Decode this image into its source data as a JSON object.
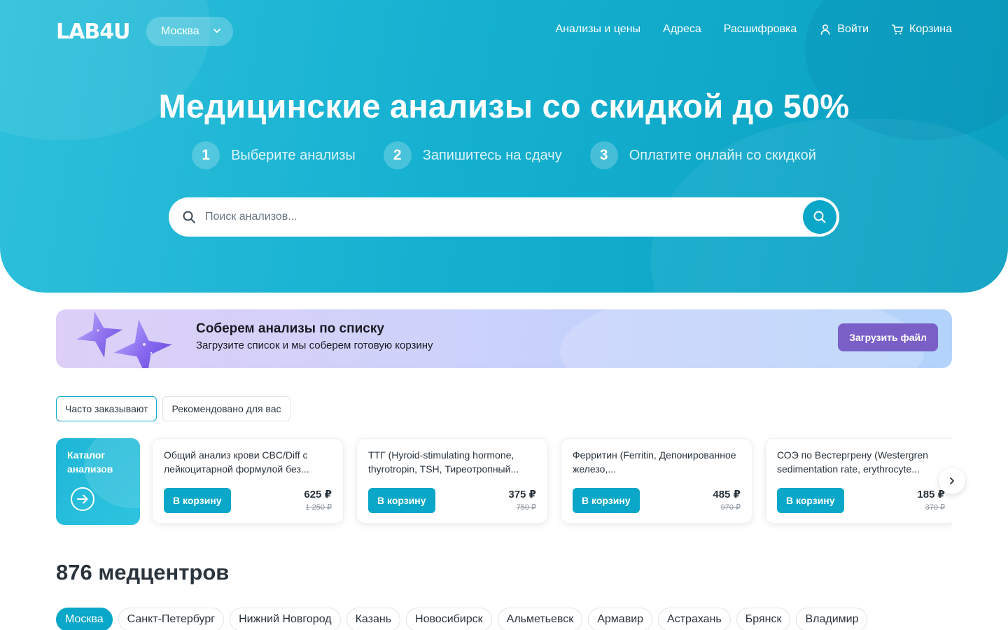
{
  "header": {
    "logo": "LAB4U",
    "city": "Москва",
    "nav": [
      {
        "label": "Анализы и цены",
        "icon": ""
      },
      {
        "label": "Адреса",
        "icon": ""
      },
      {
        "label": "Расшифровка",
        "icon": ""
      },
      {
        "label": "Войти",
        "icon": "user-icon"
      },
      {
        "label": "Корзина",
        "icon": "cart-icon"
      }
    ]
  },
  "hero": {
    "title": "Медицинские анализы со скидкой до 50%",
    "steps": [
      {
        "num": "1",
        "label": "Выберите анализы"
      },
      {
        "num": "2",
        "label": "Запишитесь на сдачу"
      },
      {
        "num": "3",
        "label": "Оплатите онлайн со скидкой"
      }
    ],
    "search_placeholder": "Поиск анализов..."
  },
  "promo": {
    "title": "Соберем анализы по списку",
    "subtitle": "Загрузите список и мы соберем готовую корзину",
    "button": "Загрузить файл"
  },
  "tabs": [
    {
      "label": "Часто заказывают",
      "active": true
    },
    {
      "label": "Рекомендовано для вас",
      "active": false
    }
  ],
  "catalog": {
    "label": "Каталог анализов"
  },
  "products": [
    {
      "title": "Общий анализ крови CBC/Diff с лейкоцитарной формулой без...",
      "button": "В корзину",
      "price": "625 ₽",
      "old_price": "1 250 ₽"
    },
    {
      "title": "ТТГ (Hyroid-stimulating hormone, thyrotropin, TSH, Тиреотропный...",
      "button": "В корзину",
      "price": "375 ₽",
      "old_price": "750 ₽"
    },
    {
      "title": "Ферритин (Ferritin, Депонированное железо,...",
      "button": "В корзину",
      "price": "485 ₽",
      "old_price": "970 ₽"
    },
    {
      "title": "СОЭ по Вестергрену (Westergren sedimentation rate, erythrocyte...",
      "button": "В корзину",
      "price": "185 ₽",
      "old_price": "370 ₽"
    }
  ],
  "centers": {
    "title": "876 медцентров",
    "cities": [
      "Москва",
      "Санкт-Петербург",
      "Нижний Новгород",
      "Казань",
      "Новосибирск",
      "Альметьевск",
      "Армавир",
      "Астрахань",
      "Брянск",
      "Владимир"
    ],
    "active_city": "Москва"
  },
  "colors": {
    "accent": "#0aa7c9",
    "hero": "#15b0d0",
    "promo_button": "#7a5fc7"
  }
}
